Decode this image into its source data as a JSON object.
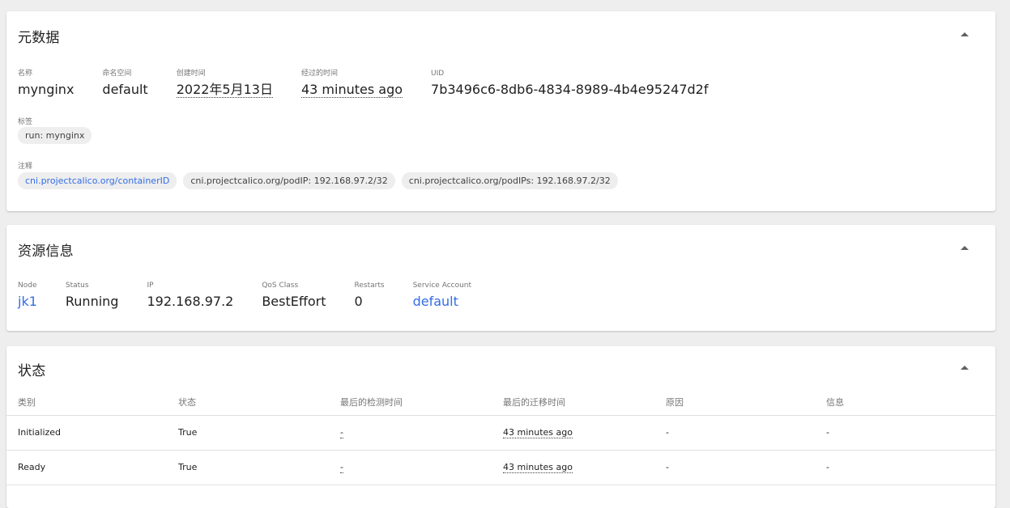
{
  "metadata": {
    "title": "元数据",
    "fields": [
      {
        "label": "名称",
        "value": "mynginx"
      },
      {
        "label": "命名空间",
        "value": "default"
      },
      {
        "label": "创建时间",
        "value": "2022年5月13日"
      },
      {
        "label": "经过的时间",
        "value": "43 minutes ago"
      },
      {
        "label": "UID",
        "value": "7b3496c6-8db6-4834-8989-4b4e95247d2f"
      }
    ],
    "labels_title": "标签",
    "labels": [
      "run: mynginx"
    ],
    "annotations_title": "注释",
    "annotations": [
      "cni.projectcalico.org/containerID",
      "cni.projectcalico.org/podIP: 192.168.97.2/32",
      "cni.projectcalico.org/podIPs: 192.168.97.2/32"
    ]
  },
  "resource": {
    "title": "资源信息",
    "fields": [
      {
        "label": "Node",
        "value": "jk1"
      },
      {
        "label": "Status",
        "value": "Running"
      },
      {
        "label": "IP",
        "value": "192.168.97.2"
      },
      {
        "label": "QoS Class",
        "value": "BestEffort"
      },
      {
        "label": "Restarts",
        "value": "0"
      },
      {
        "label": "Service Account",
        "value": "default"
      }
    ]
  },
  "conditions": {
    "title": "状态",
    "headers": [
      "类别",
      "状态",
      "最后的检测时间",
      "最后的迁移时间",
      "原因",
      "信息"
    ],
    "rows": [
      [
        "Initialized",
        "True",
        "-",
        "43 minutes ago",
        "-",
        "-"
      ],
      [
        "Ready",
        "True",
        "-",
        "43 minutes ago",
        "-",
        "-"
      ]
    ]
  },
  "colors": {
    "link": "#326de6",
    "background": "#eeeeee",
    "card": "#ffffff"
  },
  "icons": {
    "collapse": "chevron-up-icon"
  }
}
